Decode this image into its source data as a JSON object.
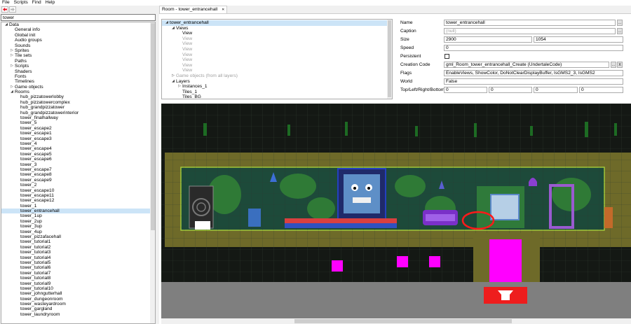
{
  "menu": [
    "File",
    "Scripts",
    "Find",
    "Help"
  ],
  "search": {
    "value": "tower"
  },
  "tree": [
    {
      "label": "Data",
      "level": 0,
      "toggle": "◢"
    },
    {
      "label": "General info",
      "level": 1
    },
    {
      "label": "Global init",
      "level": 1
    },
    {
      "label": "Audio groups",
      "level": 1
    },
    {
      "label": "Sounds",
      "level": 1
    },
    {
      "label": "Sprites",
      "level": 1,
      "toggle": "▷"
    },
    {
      "label": "Tile sets",
      "level": 1,
      "toggle": "▷"
    },
    {
      "label": "Paths",
      "level": 1
    },
    {
      "label": "Scripts",
      "level": 1,
      "toggle": "▷"
    },
    {
      "label": "Shaders",
      "level": 1
    },
    {
      "label": "Fonts",
      "level": 1
    },
    {
      "label": "Timelines",
      "level": 1
    },
    {
      "label": "Game objects",
      "level": 1,
      "toggle": "▷"
    },
    {
      "label": "Rooms",
      "level": 1,
      "toggle": "◢"
    },
    {
      "label": "hub_pizzatowerlobby",
      "level": 2
    },
    {
      "label": "hub_pizzatowercomplex",
      "level": 2
    },
    {
      "label": "hub_grandpizzatower",
      "level": 2
    },
    {
      "label": "hub_grandpizzatowerinterior",
      "level": 2
    },
    {
      "label": "tower_finalhallway",
      "level": 2
    },
    {
      "label": "tower_5",
      "level": 2
    },
    {
      "label": "tower_escape2",
      "level": 2
    },
    {
      "label": "tower_escape1",
      "level": 2
    },
    {
      "label": "tower_escape3",
      "level": 2
    },
    {
      "label": "tower_4",
      "level": 2
    },
    {
      "label": "tower_escape4",
      "level": 2
    },
    {
      "label": "tower_escape5",
      "level": 2
    },
    {
      "label": "tower_escape6",
      "level": 2
    },
    {
      "label": "tower_3",
      "level": 2
    },
    {
      "label": "tower_escape7",
      "level": 2
    },
    {
      "label": "tower_escape8",
      "level": 2
    },
    {
      "label": "tower_escape9",
      "level": 2
    },
    {
      "label": "tower_2",
      "level": 2
    },
    {
      "label": "tower_escape10",
      "level": 2
    },
    {
      "label": "tower_escape11",
      "level": 2
    },
    {
      "label": "tower_escape12",
      "level": 2
    },
    {
      "label": "tower_1",
      "level": 2
    },
    {
      "label": "tower_entrancehall",
      "level": 2,
      "selected": true
    },
    {
      "label": "tower_1up",
      "level": 2
    },
    {
      "label": "tower_2up",
      "level": 2
    },
    {
      "label": "tower_3up",
      "level": 2
    },
    {
      "label": "tower_4up",
      "level": 2
    },
    {
      "label": "tower_pizzafacehall",
      "level": 2
    },
    {
      "label": "tower_tutorial1",
      "level": 2
    },
    {
      "label": "tower_tutorial2",
      "level": 2
    },
    {
      "label": "tower_tutorial3",
      "level": 2
    },
    {
      "label": "tower_tutorial4",
      "level": 2
    },
    {
      "label": "tower_tutorial5",
      "level": 2
    },
    {
      "label": "tower_tutorial6",
      "level": 2
    },
    {
      "label": "tower_tutorial7",
      "level": 2
    },
    {
      "label": "tower_tutorial8",
      "level": 2
    },
    {
      "label": "tower_tutorial9",
      "level": 2
    },
    {
      "label": "tower_tutorial10",
      "level": 2
    },
    {
      "label": "tower_johngutterhall",
      "level": 2
    },
    {
      "label": "tower_dungeonroom",
      "level": 2
    },
    {
      "label": "tower_wasteyardroom",
      "level": 2
    },
    {
      "label": "tower_gargland",
      "level": 2
    },
    {
      "label": "tower_laundryroom",
      "level": 2
    }
  ],
  "tab": {
    "title": "Room - tower_entrancehall",
    "close": "✕"
  },
  "room_tree": [
    {
      "label": "tower_entrancehall",
      "level": 0,
      "toggle": "◢",
      "selected": true
    },
    {
      "label": "Views",
      "level": 1,
      "toggle": "◢"
    },
    {
      "label": "View",
      "level": 2
    },
    {
      "label": "View",
      "level": 2,
      "gray": true
    },
    {
      "label": "View",
      "level": 2,
      "gray": true
    },
    {
      "label": "View",
      "level": 2,
      "gray": true
    },
    {
      "label": "View",
      "level": 2,
      "gray": true
    },
    {
      "label": "View",
      "level": 2,
      "gray": true
    },
    {
      "label": "View",
      "level": 2,
      "gray": true
    },
    {
      "label": "View",
      "level": 2,
      "gray": true
    },
    {
      "label": "Game objects (from all layers)",
      "level": 1,
      "toggle": "▷",
      "gray": true
    },
    {
      "label": "Layers",
      "level": 1,
      "toggle": "◢"
    },
    {
      "label": "Instances_1",
      "level": 2,
      "toggle": "▷"
    },
    {
      "label": "Tiles_1",
      "level": 2
    },
    {
      "label": "Tiles_BG",
      "level": 2
    }
  ],
  "props": {
    "name_label": "Name",
    "name_value": "tower_entrancehall",
    "caption_label": "Caption",
    "caption_value": "(null)",
    "size_label": "Size",
    "size_w": "2900",
    "size_h": "1054",
    "speed_label": "Speed",
    "speed_value": "0",
    "persistent_label": "Persistent",
    "creation_label": "Creation Code",
    "creation_value": "gml_Room_tower_entrancehall_Create (UndertaleCode)",
    "flags_label": "Flags",
    "flags_value": "EnableViews, ShowColor, DoNotClearDisplayBuffer, IsGMS2_3, IsGMS2",
    "world_label": "World",
    "world_value": "False",
    "tlbr_label": "Top/Left/Right/Bottom",
    "tlbr": [
      "0",
      "0",
      "0",
      "0"
    ],
    "browse": "...",
    "clear": "X"
  },
  "colors": {
    "accent": "#0078d7",
    "magenta": "#ff00ff",
    "red": "#ff1a1a",
    "wall": "#6c6b2c",
    "floor": "#7f7f7f"
  }
}
